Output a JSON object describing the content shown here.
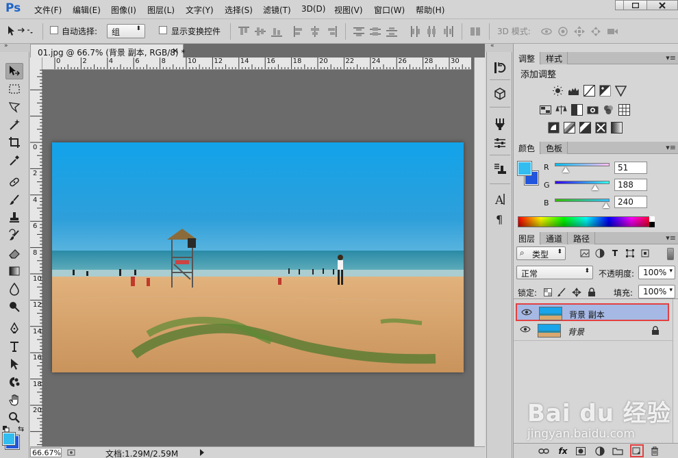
{
  "app": {
    "logo": "Ps"
  },
  "menu": [
    "文件(F)",
    "编辑(E)",
    "图像(I)",
    "图层(L)",
    "文字(Y)",
    "选择(S)",
    "滤镜(T)",
    "3D(D)",
    "视图(V)",
    "窗口(W)",
    "帮助(H)"
  ],
  "options": {
    "auto_select_label": "自动选择:",
    "auto_select_value": "组",
    "show_transform_label": "显示变换控件",
    "mode_3d_label": "3D 模式:"
  },
  "document": {
    "tab_title": "01.jpg @ 66.7% (背景 副本, RGB/8) *",
    "close": "×",
    "ruler_h": [
      "0",
      "2",
      "4",
      "6",
      "8",
      "10",
      "12",
      "14",
      "16",
      "18",
      "20",
      "22",
      "24",
      "26",
      "28",
      "30"
    ],
    "ruler_v": [
      "0",
      "2",
      "4",
      "6",
      "8",
      "10",
      "12",
      "14",
      "16",
      "18",
      "20"
    ],
    "zoom": "66.67%",
    "doc_size": "文档:1.29M/2.59M"
  },
  "adjust_panel": {
    "tabs": [
      "调整",
      "样式"
    ],
    "title": "添加调整"
  },
  "color_panel": {
    "tabs": [
      "颜色",
      "色板"
    ],
    "r_label": "R",
    "g_label": "G",
    "b_label": "B",
    "r": "51",
    "g": "188",
    "b": "240",
    "fg_color": "#33bcf0",
    "bg_color": "#2255dd"
  },
  "layers_panel": {
    "tabs": [
      "图层",
      "通道",
      "路径"
    ],
    "filter_label": "类型",
    "blend_mode": "正常",
    "opacity_label": "不透明度:",
    "opacity": "100%",
    "lock_label": "锁定:",
    "fill_label": "填充:",
    "fill": "100%",
    "layers": [
      {
        "name": "背景 副本",
        "selected": true,
        "locked": false
      },
      {
        "name": "背景",
        "selected": false,
        "locked": true
      }
    ]
  },
  "watermark": {
    "brand": "Bai du 经验",
    "url": "jingyan.baidu.com"
  }
}
